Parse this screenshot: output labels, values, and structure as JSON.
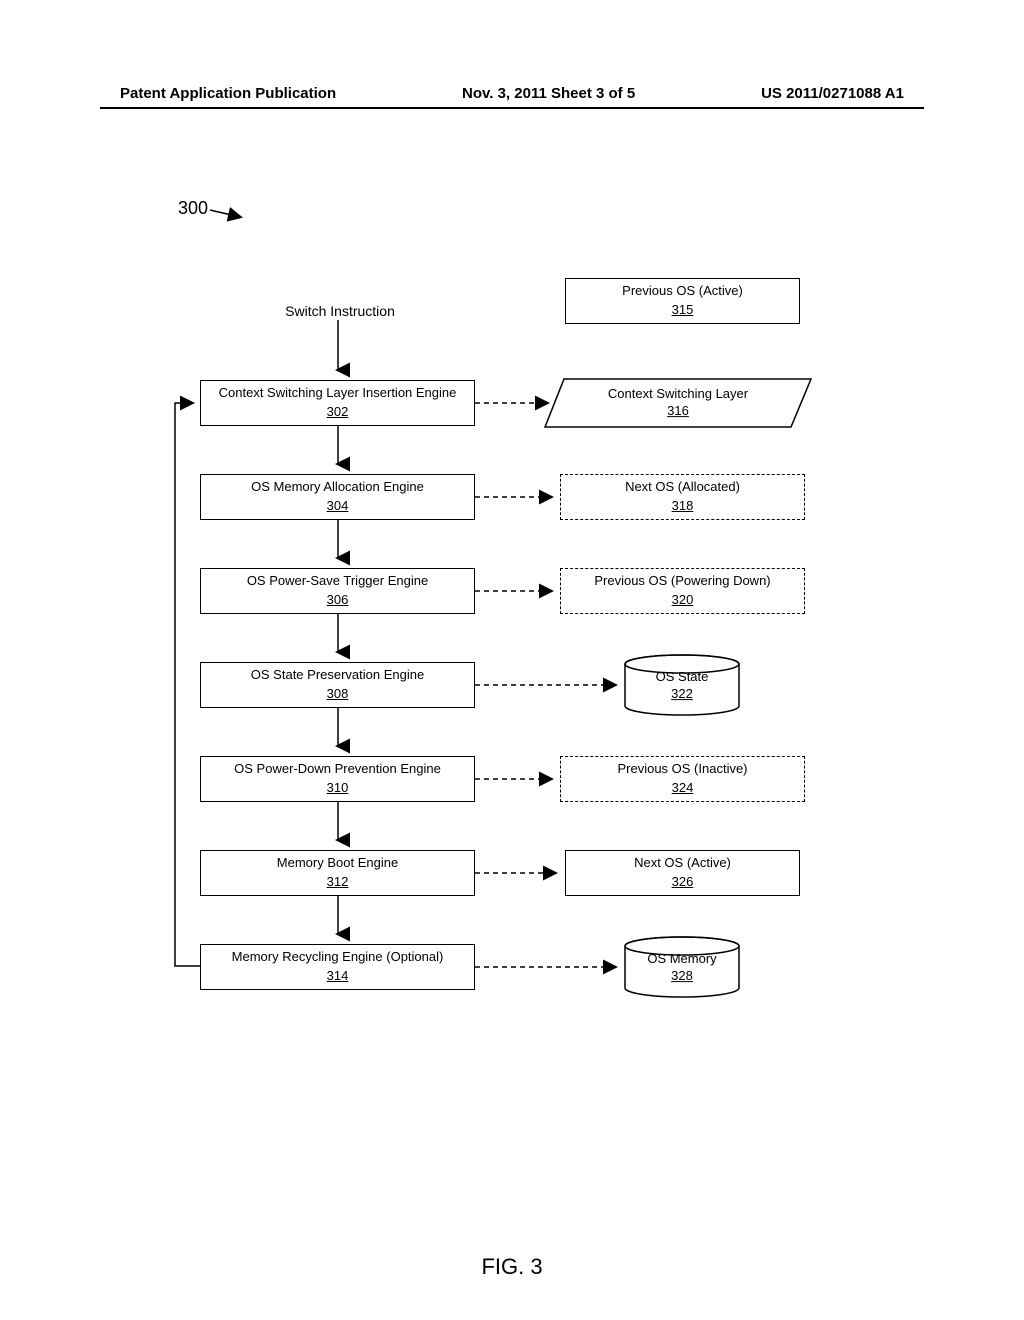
{
  "header": {
    "left": "Patent Application Publication",
    "center": "Nov. 3, 2011   Sheet 3 of 5",
    "right": "US 2011/0271088 A1"
  },
  "diagram_ref": "300",
  "switch_instruction": "Switch Instruction",
  "engines": {
    "e302": {
      "label": "Context Switching Layer Insertion Engine",
      "ref": "302"
    },
    "e304": {
      "label": "OS Memory Allocation Engine",
      "ref": "304"
    },
    "e306": {
      "label": "OS Power-Save Trigger Engine",
      "ref": "306"
    },
    "e308": {
      "label": "OS State Preservation Engine",
      "ref": "308"
    },
    "e310": {
      "label": "OS Power-Down Prevention Engine",
      "ref": "310"
    },
    "e312": {
      "label": "Memory Boot Engine",
      "ref": "312"
    },
    "e314": {
      "label": "Memory Recycling Engine (Optional)",
      "ref": "314"
    }
  },
  "right_nodes": {
    "n315": {
      "label": "Previous OS (Active)",
      "ref": "315"
    },
    "n316": {
      "label": "Context Switching Layer",
      "ref": "316"
    },
    "n318": {
      "label": "Next OS (Allocated)",
      "ref": "318"
    },
    "n320": {
      "label": "Previous OS (Powering Down)",
      "ref": "320"
    },
    "n322": {
      "label": "OS State",
      "ref": "322"
    },
    "n324": {
      "label": "Previous OS (Inactive)",
      "ref": "324"
    },
    "n326": {
      "label": "Next OS (Active)",
      "ref": "326"
    },
    "n328": {
      "label": "OS Memory",
      "ref": "328"
    }
  },
  "figure_label": "FIG. 3"
}
